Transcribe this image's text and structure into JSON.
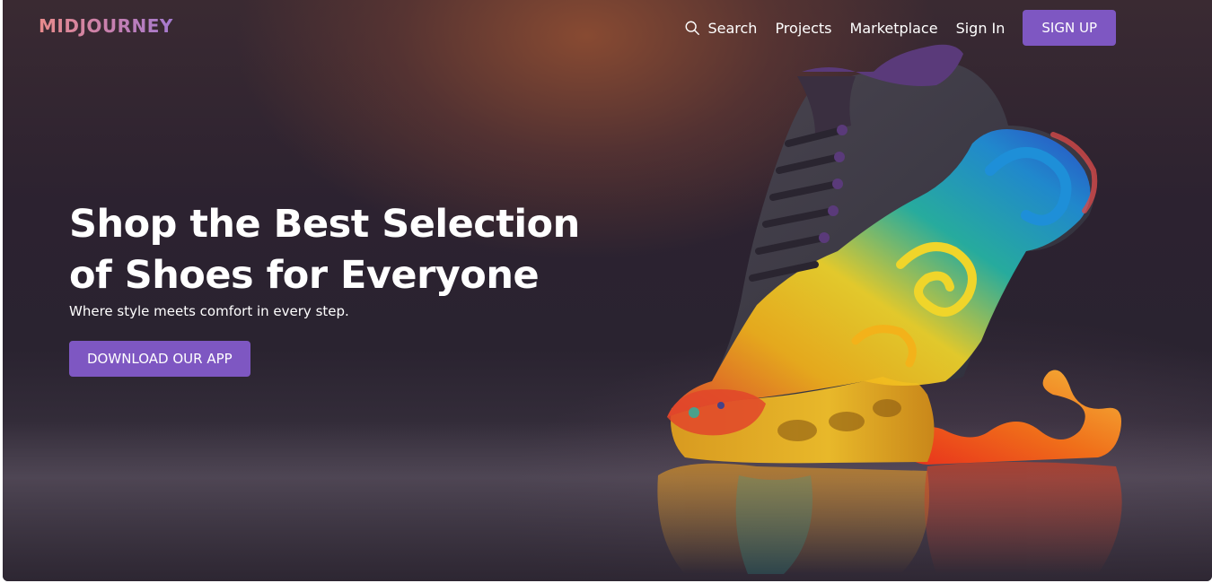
{
  "header": {
    "brand": "MIDJOURNEY",
    "nav": {
      "search_label": "Search",
      "projects_label": "Projects",
      "marketplace_label": "Marketplace",
      "signin_label": "Sign In",
      "signup_label": "SIGN UP"
    },
    "icons": {
      "search": "search-icon"
    }
  },
  "hero": {
    "title": "Shop the Best Selection of Shoes for Everyone",
    "subtitle": "Where style meets comfort in every step.",
    "cta_label": "DOWNLOAD OUR APP",
    "image": "colorful-sneaker-image"
  },
  "colors": {
    "accent": "#7e57c2",
    "background": "#2c2230",
    "text": "#ffffff"
  }
}
